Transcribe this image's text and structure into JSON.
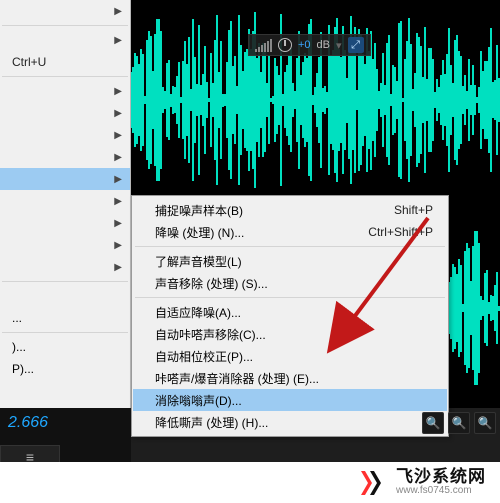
{
  "toolbar": {
    "db_value": "+0",
    "db_unit": "dB"
  },
  "left_menu": {
    "shortcut_row2": "Ctrl+U",
    "items_tail": [
      "",
      "...",
      ")...",
      "P)..."
    ]
  },
  "submenu": {
    "items": [
      {
        "label": "捕捉噪声样本(B)",
        "shortcut": "Shift+P"
      },
      {
        "label": "降噪 (处理) (N)...",
        "shortcut": "Ctrl+Shift+P"
      }
    ],
    "group2": [
      "了解声音模型(L)",
      "声音移除 (处理) (S)..."
    ],
    "group3": [
      "自适应降噪(A)...",
      "自动咔嗒声移除(C)...",
      "自动相位校正(P)...",
      "咔嗒声/爆音消除器 (处理) (E)...",
      "消除嗡嗡声(D)...",
      "降低嘶声 (处理) (H)..."
    ],
    "highlighted": "消除嗡嗡声(D)..."
  },
  "timecode": "2.666",
  "watermark": {
    "name": "飞沙系统网",
    "url": "www.fs0745.com"
  }
}
